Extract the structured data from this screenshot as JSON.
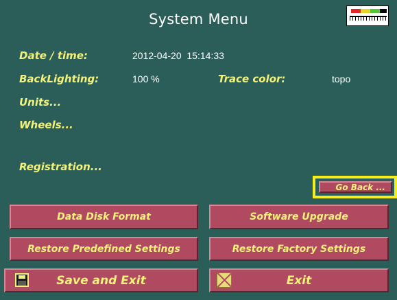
{
  "header": {
    "title": "System Menu",
    "scale_icon": "color-scale-icon"
  },
  "settings": {
    "date_time": {
      "label": "Date / time:",
      "value": "2012-04-20  15:14:33"
    },
    "backlighting": {
      "label": "BackLighting:",
      "value": "100 %"
    },
    "trace_color": {
      "label": "Trace color:",
      "value": "topo"
    },
    "units": {
      "label": "Units..."
    },
    "wheels": {
      "label": "Wheels..."
    },
    "registration": {
      "label": "Registration..."
    }
  },
  "buttons": {
    "go_back": "Go Back ...",
    "data_disk_format": "Data Disk Format",
    "software_upgrade": "Software Upgrade",
    "restore_predefined": "Restore Predefined Settings",
    "restore_factory": "Restore Factory Settings",
    "save_and_exit": "Save and Exit",
    "exit": "Exit"
  },
  "icons": {
    "save": "floppy-disk-icon",
    "exit": "close-x-icon"
  },
  "colors": {
    "background": "#2c5e59",
    "label_yellow": "#f2f27a",
    "button_fill": "#b04a61",
    "highlight_yellow": "#f4ee20"
  }
}
